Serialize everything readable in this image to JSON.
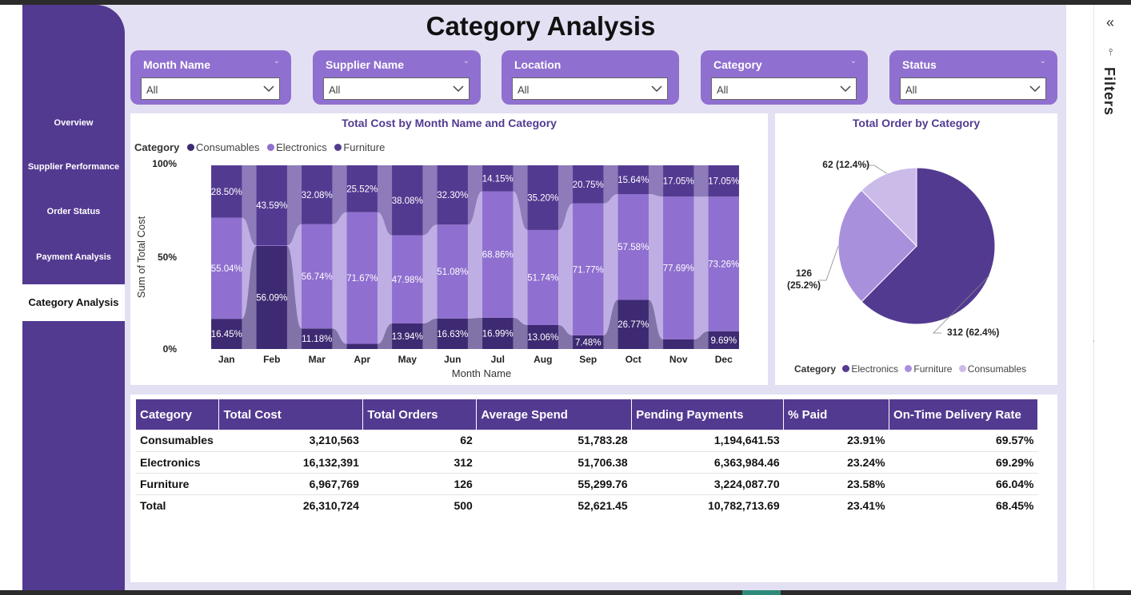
{
  "page": {
    "title": "Category Analysis"
  },
  "sidebar": {
    "items": [
      {
        "label": "Overview",
        "active": false
      },
      {
        "label": "Supplier Performance",
        "active": false
      },
      {
        "label": "Order Status",
        "active": false
      },
      {
        "label": "Payment Analysis",
        "active": false
      },
      {
        "label": "Category Analysis",
        "active": true
      }
    ]
  },
  "slicers": [
    {
      "title": "Month Name",
      "value": "All"
    },
    {
      "title": "Supplier Name",
      "value": "All"
    },
    {
      "title": "Location",
      "value": "All"
    },
    {
      "title": "Category",
      "value": "All"
    },
    {
      "title": "Status",
      "value": "All"
    }
  ],
  "ribbon": {
    "title": "Total Cost by Month Name and Category",
    "legend_title": "Category",
    "legend": [
      {
        "label": "Consumables",
        "color": "#3e2a72"
      },
      {
        "label": "Electronics",
        "color": "#8f6fcf"
      },
      {
        "label": "Furniture",
        "color": "#533a91"
      }
    ],
    "ylabel": "Sum of Total Cost",
    "xlabel": "Month Name",
    "yticks": [
      "100%",
      "50%",
      "0%"
    ]
  },
  "pie": {
    "title": "Total Order by Category",
    "legend_title": "Category",
    "legend": [
      {
        "label": "Electronics",
        "color": "#533a91"
      },
      {
        "label": "Furniture",
        "color": "#a990dc"
      },
      {
        "label": "Consumables",
        "color": "#cbbbe9"
      }
    ],
    "labels": [
      {
        "line1": "312 (62.4%)",
        "line2": ""
      },
      {
        "line1": "126",
        "line2": "(25.2%)"
      },
      {
        "line1": "62 (12.4%)",
        "line2": ""
      }
    ]
  },
  "chart_data": [
    {
      "type": "bar",
      "stacked": "100%",
      "title": "Total Cost by Month Name and Category",
      "xlabel": "Month Name",
      "ylabel": "Sum of Total Cost",
      "categories": [
        "Jan",
        "Feb",
        "Mar",
        "Apr",
        "May",
        "Jun",
        "Jul",
        "Aug",
        "Sep",
        "Oct",
        "Nov",
        "Dec"
      ],
      "series": [
        {
          "name": "Furniture",
          "color": "#533a91",
          "values": [
            28.5,
            43.59,
            32.08,
            25.52,
            38.08,
            32.3,
            14.15,
            35.2,
            20.75,
            15.64,
            17.05,
            17.05
          ]
        },
        {
          "name": "Electronics",
          "color": "#8f6fcf",
          "values": [
            55.04,
            0.32,
            56.74,
            71.67,
            47.98,
            51.08,
            68.86,
            51.74,
            71.77,
            57.58,
            77.69,
            73.26
          ]
        },
        {
          "name": "Consumables",
          "color": "#3e2a72",
          "values": [
            16.45,
            56.09,
            11.18,
            2.81,
            13.94,
            16.63,
            16.99,
            13.06,
            7.48,
            26.77,
            5.26,
            9.69
          ]
        }
      ],
      "data_labels": [
        [
          "28.50%",
          "55.04%",
          "16.45%"
        ],
        [
          "43.59%",
          "",
          "56.09%"
        ],
        [
          "32.08%",
          "56.74%",
          "11.18%"
        ],
        [
          "25.52%",
          "71.67%",
          ""
        ],
        [
          "38.08%",
          "47.98%",
          "13.94%"
        ],
        [
          "32.30%",
          "51.08%",
          "16.63%"
        ],
        [
          "14.15%",
          "68.86%",
          "16.99%"
        ],
        [
          "35.20%",
          "51.74%",
          "13.06%"
        ],
        [
          "20.75%",
          "71.77%",
          "7.48%"
        ],
        [
          "15.64%",
          "57.58%",
          "26.77%"
        ],
        [
          "17.05%",
          "77.69%",
          ""
        ],
        [
          "17.05%",
          "73.26%",
          "9.69%"
        ]
      ],
      "ylim": [
        0,
        100
      ],
      "legend_position": "top-left"
    },
    {
      "type": "pie",
      "title": "Total Order by Category",
      "categories": [
        "Electronics",
        "Furniture",
        "Consumables"
      ],
      "values": [
        312,
        126,
        62
      ],
      "percent": [
        62.4,
        25.2,
        12.4
      ],
      "colors": [
        "#533a91",
        "#a990dc",
        "#cbbbe9"
      ],
      "legend_position": "bottom"
    }
  ],
  "table": {
    "columns": [
      "Category",
      "Total Cost",
      "Total Orders",
      "Average Spend",
      "Pending Payments",
      "% Paid",
      "On-Time Delivery Rate"
    ],
    "rows": [
      [
        "Consumables",
        "3,210,563",
        "62",
        "51,783.28",
        "1,194,641.53",
        "23.91%",
        "69.57%"
      ],
      [
        "Electronics",
        "16,132,391",
        "312",
        "51,706.38",
        "6,363,984.46",
        "23.24%",
        "69.29%"
      ],
      [
        "Furniture",
        "6,967,769",
        "126",
        "55,299.76",
        "3,224,087.70",
        "23.58%",
        "66.04%"
      ]
    ],
    "total": [
      "Total",
      "26,310,724",
      "500",
      "52,621.45",
      "10,782,713.69",
      "23.41%",
      "68.45%"
    ]
  },
  "filters_pane": {
    "label": "Filters",
    "collapse_glyph": "«",
    "icon_glyph": "⫯"
  }
}
